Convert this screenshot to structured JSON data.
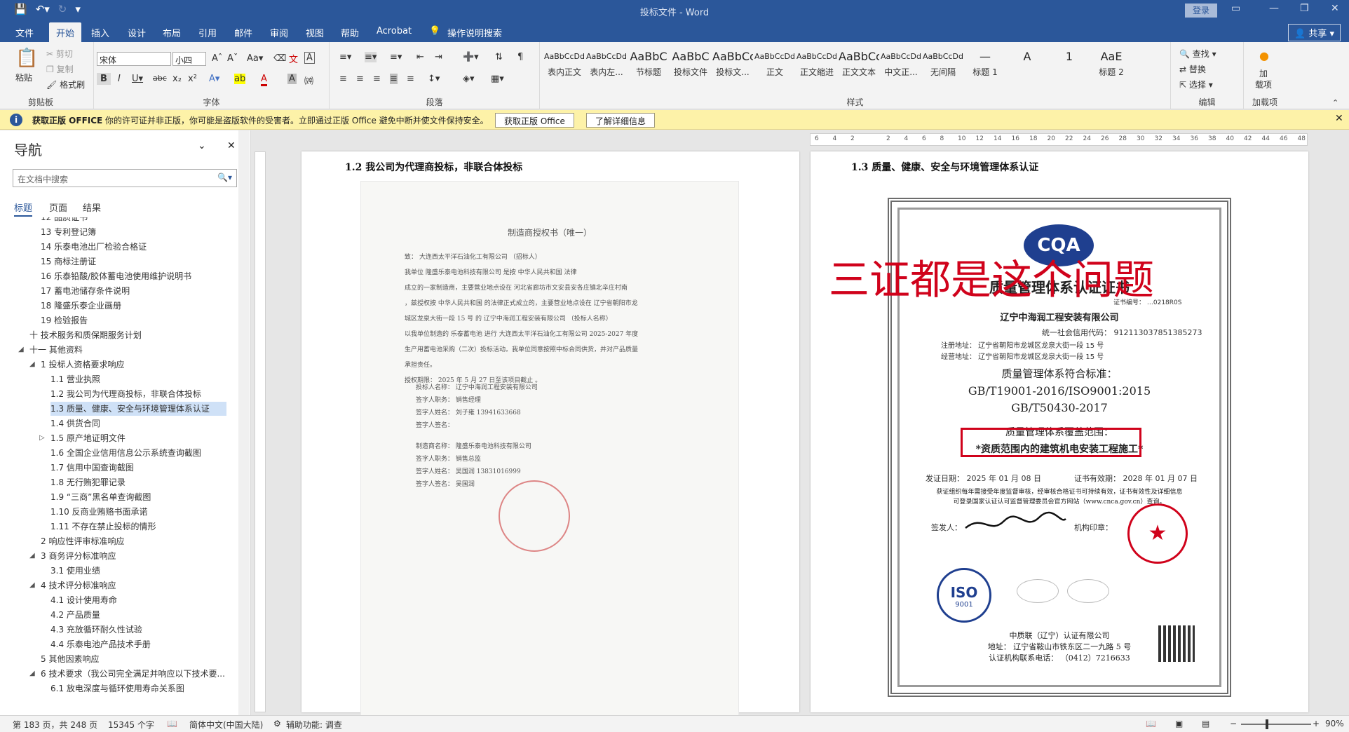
{
  "window": {
    "title": "投标文件 - Word",
    "login": "登录"
  },
  "tabs": [
    "文件",
    "开始",
    "插入",
    "设计",
    "布局",
    "引用",
    "邮件",
    "审阅",
    "视图",
    "帮助",
    "Acrobat",
    "操作说明搜索"
  ],
  "share": "共享",
  "ribbon": {
    "clipboard": {
      "paste": "粘贴",
      "cut": "剪切",
      "copy": "复制",
      "format_painter": "格式刷",
      "label": "剪贴板"
    },
    "font": {
      "name": "宋体",
      "size": "小四",
      "label": "字体"
    },
    "paragraph": {
      "label": "段落"
    },
    "styles": {
      "label": "样式",
      "items": [
        {
          "sample": "AaBbCcDdI",
          "name": "表内正文"
        },
        {
          "sample": "AaBbCcDdEe",
          "name": "表内左..."
        },
        {
          "sample": "AaBbC",
          "name": "节标题"
        },
        {
          "sample": "AaBbC",
          "name": "投标文件"
        },
        {
          "sample": "AaBbCc",
          "name": "投标文..."
        },
        {
          "sample": "AaBbCcDdI",
          "name": "正文"
        },
        {
          "sample": "AaBbCcDdI",
          "name": "正文缩进"
        },
        {
          "sample": "AaBbCc",
          "name": "正文文本"
        },
        {
          "sample": "AaBbCcDd",
          "name": "中文正..."
        },
        {
          "sample": "AaBbCcDdI",
          "name": "无间隔"
        },
        {
          "sample": "—",
          "name": "标题 1"
        },
        {
          "sample": "A",
          "name": ""
        },
        {
          "sample": "1",
          "name": ""
        },
        {
          "sample": "AaE",
          "name": "标题 2"
        }
      ]
    },
    "editing": {
      "find": "查找",
      "replace": "替换",
      "select": "选择",
      "label": "编辑"
    },
    "addins": {
      "label1": "加",
      "label2": "载项",
      "label": "加载项"
    }
  },
  "message_bar": {
    "title": "获取正版 OFFICE",
    "text": "你的许可证并非正版，你可能是盗版软件的受害者。立即通过正版 Office 避免中断并使文件保持安全。",
    "btn1": "获取正版 Office",
    "btn2": "了解详细信息"
  },
  "nav": {
    "title": "导航",
    "search_placeholder": "在文档中搜索",
    "tabs": [
      "标题",
      "页面",
      "结果"
    ],
    "items": [
      {
        "label": "12 品质证书",
        "indent": 1
      },
      {
        "label": "13 专利登记簿",
        "indent": 1
      },
      {
        "label": "14 乐泰电池出厂检验合格证",
        "indent": 1
      },
      {
        "label": "15 商标注册证",
        "indent": 1
      },
      {
        "label": "16 乐泰铅酸/胶体蓄电池使用维护说明书",
        "indent": 1
      },
      {
        "label": "17 蓄电池储存条件说明",
        "indent": 1
      },
      {
        "label": "18 隆盛乐泰企业画册",
        "indent": 1
      },
      {
        "label": "19 检验报告",
        "indent": 1
      },
      {
        "label": "十 技术服务和质保期服务计划",
        "indent": 0
      },
      {
        "label": "十一 其他资料",
        "indent": 0,
        "tw": "◢"
      },
      {
        "label": "1 投标人资格要求响应",
        "indent": 1,
        "tw": "◢"
      },
      {
        "label": "1.1 营业执照",
        "indent": 2
      },
      {
        "label": "1.2 我公司为代理商投标，非联合体投标",
        "indent": 2
      },
      {
        "label": "1.3 质量、健康、安全与环境管理体系认证",
        "indent": 2,
        "sel": true
      },
      {
        "label": "1.4 供货合同",
        "indent": 2
      },
      {
        "label": "1.5 原产地证明文件",
        "indent": 2,
        "tw": "▷"
      },
      {
        "label": "1.6 全国企业信用信息公示系统查询截图",
        "indent": 2
      },
      {
        "label": "1.7 信用中国查询截图",
        "indent": 2
      },
      {
        "label": "1.8 无行贿犯罪记录",
        "indent": 2
      },
      {
        "label": "1.9 “三商”黑名单查询截图",
        "indent": 2
      },
      {
        "label": "1.10 反商业贿赂书面承诺",
        "indent": 2
      },
      {
        "label": "1.11 不存在禁止投标的情形",
        "indent": 2
      },
      {
        "label": "2 响应性评审标准响应",
        "indent": 1
      },
      {
        "label": "3 商务评分标准响应",
        "indent": 1,
        "tw": "◢"
      },
      {
        "label": "3.1 使用业绩",
        "indent": 2
      },
      {
        "label": "4 技术评分标准响应",
        "indent": 1,
        "tw": "◢"
      },
      {
        "label": "4.1 设计使用寿命",
        "indent": 2
      },
      {
        "label": "4.2 产品质量",
        "indent": 2
      },
      {
        "label": "4.3 充放循环耐久性试验",
        "indent": 2
      },
      {
        "label": "4.4 乐泰电池产品技术手册",
        "indent": 2
      },
      {
        "label": "5 其他因素响应",
        "indent": 1
      },
      {
        "label": "6 技术要求（我公司完全满足并响应以下技术要...",
        "indent": 1,
        "tw": "◢"
      },
      {
        "label": "6.1 放电深度与循环使用寿命关系图",
        "indent": 2
      }
    ]
  },
  "ruler_numbers": [
    "6",
    "4",
    "2",
    "",
    "2",
    "4",
    "6",
    "8",
    "10",
    "12",
    "14",
    "16",
    "18",
    "20",
    "22",
    "24",
    "26",
    "28",
    "30",
    "32",
    "34",
    "36",
    "38",
    "40",
    "42",
    "44",
    "46",
    "48"
  ],
  "page1": {
    "heading": "1.2 我公司为代理商投标，非联合体投标",
    "doc_title": "制造商授权书（唯一）",
    "lines": [
      "致：  大连西太平洋石油化工有限公司        （招标人）",
      "    我单位   隆盛乐泰电池科技有限公司   是按   中华人民共和国                法律",
      "成立的一家制造商，主要营业地点设在    河北省廊坊市文安县安各庄镇北辛庄村南",
      "，兹授权按  中华人民共和国   的法律正式成立的，主要营业地点设在   辽宁省朝阳市龙",
      "城区龙泉大街一段 15 号          的      辽宁中海润工程安装有限公司      （投标人名称）",
      "以我单位制造的   乐泰蓄电池    进行   大连西太平洋石油化工有限公司 2025-2027 年度",
      "生产用蓄电池采购（二次）投标活动。我单位同意按照中标合同供货，并对产品质量",
      "承担责任。",
      "    授权期限：   2025 年 5 月 27 日至该项目截止                              。"
    ],
    "sig1": [
      "投标人名称：  辽宁中海润工程安装有限公司",
      "签字人职务：     销售经理",
      "签字人姓名：     刘子雍 13941633668",
      "签字人签名："
    ],
    "sig2": [
      "制造商名称：  隆盛乐泰电池科技有限公司",
      "签字人职务：     销售总监",
      "签字人姓名：     吴国润 13831016999",
      "签字人签名：    吴国润"
    ]
  },
  "page2": {
    "heading": "1.3 质量、健康、安全与环境管理体系认证",
    "logo": "CQA",
    "cert_title": "质量管理体系认证证书",
    "cert_no": "证书编号：  …0218R0S",
    "company": "辽宁中海润工程安装有限公司",
    "credit": "统一社会信用代码：  912113037851385273",
    "reg_addr": "注册地址：  辽宁省朝阳市龙城区龙泉大街一段 15 号",
    "op_addr": "经营地址：  辽宁省朝阳市龙城区龙泉大街一段 15 号",
    "std_title": "质量管理体系符合标准：",
    "std1": "GB/T19001-2016/ISO9001:2015",
    "std2": "GB/T50430-2017",
    "scope_title": "质量管理体系覆盖范围：",
    "scope": "*资质范围内的建筑机电安装工程施工*",
    "issue": "发证日期：  2025 年 01 月 08 日",
    "valid": "证书有效期：  2028 年 01 月 07 日",
    "note1": "获证组织每年需接受年度监督审核，经审核合格证书可持续有效，证书有效性及详细信息",
    "note2": "可登录国家认证认可监督管理委员会官方网站（www.cnca.gov.cn）查询。",
    "signer": "签发人：",
    "seal_label": "机构印章：",
    "iso": "ISO",
    "iso_sub": "9001",
    "org": "中质联（辽宁）认证有限公司",
    "org_addr": "地址：  辽宁省鞍山市铁东区二一九路 5 号",
    "org_tel": "认证机构联系电话：  （0412）7216633",
    "note": "三证都是这个问题"
  },
  "status": {
    "page": "第 183 页，共 248 页",
    "words": "15345 个字",
    "lang": "简体中文(中国大陆)",
    "access": "辅助功能: 调查",
    "zoom": "90%"
  }
}
